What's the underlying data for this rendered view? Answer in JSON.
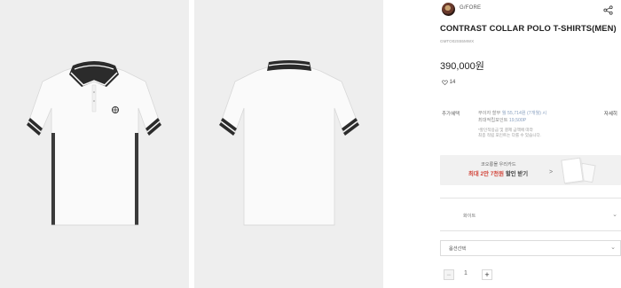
{
  "gallery": {
    "images": [
      {
        "name": "polo-front-image"
      },
      {
        "name": "polo-back-image"
      }
    ]
  },
  "product": {
    "brand": "G/FORE",
    "share_icon": "share-icon",
    "title": "CONTRAST COLLAR POLO T-SHIRTS(MEN)",
    "code": "GMTO02S55MWX",
    "price": "390,000원",
    "likes": "14",
    "heart_icon": "heart-icon"
  },
  "benefits": {
    "label": "추가혜택",
    "installment": "무이자 할부",
    "installment_amount": "월 55,714원 (7개월) 시",
    "points_label": "최대적립포인트",
    "points_value": "19,500P",
    "note_1": "*할인적용금 및 결제 금액에 따라",
    "note_2": "최종 적립 포인트는 다를 수 있습니다.",
    "detail_link": "자세히"
  },
  "card_banner": {
    "line1": "코오롱몰 우리카드",
    "line2_prefix": "최대 2만 7천원",
    "line2_suffix": " 할인 받기",
    "chevron": ">"
  },
  "color_selector": {
    "value": "화이트",
    "chevron": "⌄"
  },
  "option_select": {
    "placeholder": "옵션선택",
    "chevron": "⌄"
  },
  "quantity": {
    "minus": "−",
    "value": "1",
    "plus": "+"
  },
  "colors": {
    "bg_photo": "#eeeeee",
    "accent_red": "#d2453a",
    "collar_dark": "#2b2b2b"
  }
}
